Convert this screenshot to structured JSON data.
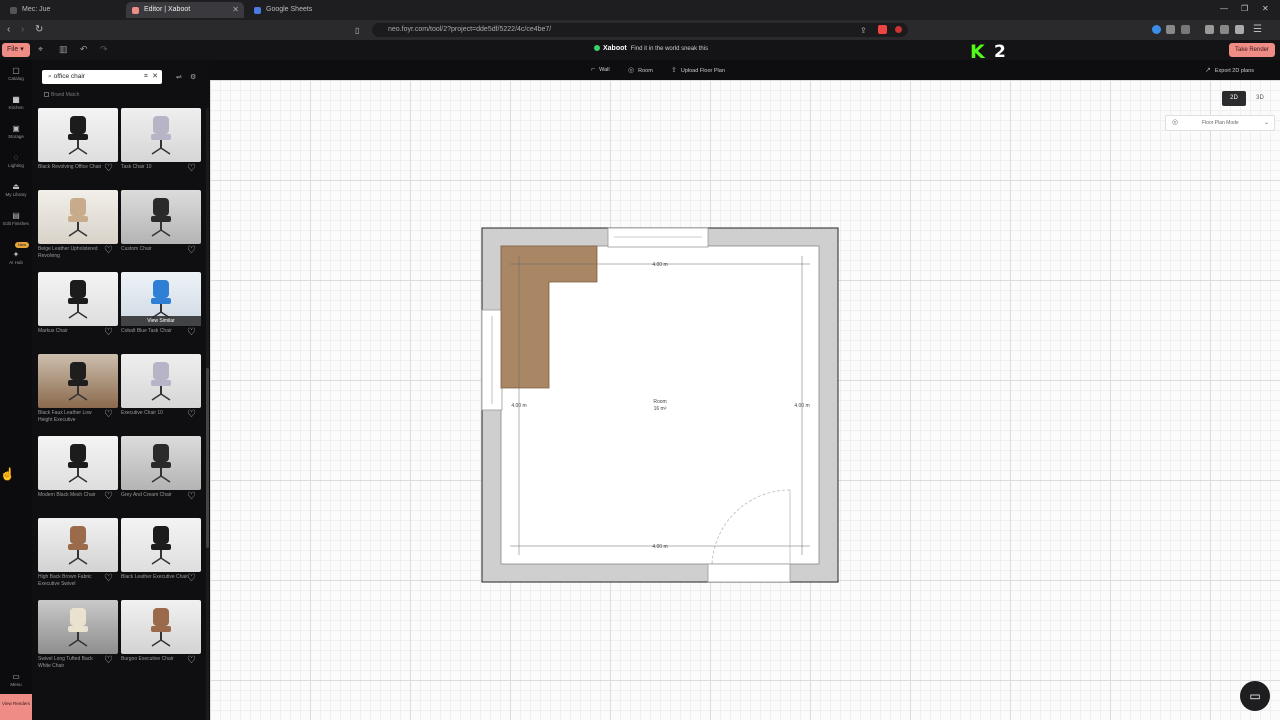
{
  "browser": {
    "tabs": [
      {
        "label": "Mec: Jue",
        "active": false
      },
      {
        "label": "Editor | Xaboot",
        "active": true
      },
      {
        "label": "Google Sheets",
        "active": false
      }
    ],
    "url": "neo.foyr.com/tool/2?project=dde5df/5222/4c/ce4be7/"
  },
  "app": {
    "file_label": "File",
    "brand_name": "Xaboot",
    "brand_tagline": "Find it in the world sneak this",
    "take_render_label": "Take Render",
    "stream": {
      "logo": "K",
      "count": "2"
    }
  },
  "rail": {
    "items": [
      {
        "label": "Catalog",
        "icon": "catalog-icon"
      },
      {
        "label": "Kitchen",
        "icon": "kitchen-icon"
      },
      {
        "label": "Storage",
        "icon": "storage-icon"
      },
      {
        "label": "Lighting",
        "icon": "lighting-icon"
      },
      {
        "label": "My Library",
        "icon": "library-icon"
      },
      {
        "label": "Edit Finishes",
        "icon": "finishes-icon"
      },
      {
        "label": "AI Hub",
        "icon": "ai-hub-icon",
        "badge": "New"
      }
    ],
    "bottom_items": [
      {
        "label": "Menu",
        "icon": "menu-icon"
      }
    ],
    "view_renders_label": "View Renders"
  },
  "panel": {
    "search_value": "office chair",
    "toggle_label": "Brand Match",
    "view_similar_label": "View Similar",
    "products": [
      {
        "name": "Black Revolving Office Chair",
        "swatch": "dark"
      },
      {
        "name": "Task Chair 10",
        "swatch": "light"
      },
      {
        "name": "Beige Leather Upholstered Revolving",
        "swatch": "beige"
      },
      {
        "name": "Custom Chair",
        "swatch": "gray"
      },
      {
        "name": "Markus Chair",
        "swatch": "dark"
      },
      {
        "name": "Cobalt Blue Task Chair",
        "swatch": "blue"
      },
      {
        "name": "Black Faux Leather Low Height Executive",
        "swatch": "wood"
      },
      {
        "name": "Executive Chair 10",
        "swatch": "light"
      },
      {
        "name": "Modern Black Mesh Chair",
        "swatch": "dark"
      },
      {
        "name": "Grey And Cream Chair",
        "swatch": "gray"
      },
      {
        "name": "High Back Brown Fabric Executive Swivel",
        "swatch": "brown"
      },
      {
        "name": "Black Leather Executive Chair",
        "swatch": "dark"
      },
      {
        "name": "Swivel Long Tufted Back White Chair",
        "swatch": "cream"
      },
      {
        "name": "Burgoo Executive Chair",
        "swatch": "brown"
      }
    ]
  },
  "canvas": {
    "tools": [
      {
        "label": "Wall",
        "icon": "wall-icon"
      },
      {
        "label": "Room",
        "icon": "room-icon"
      },
      {
        "label": "Upload Floor Plan",
        "icon": "upload-icon"
      }
    ],
    "export_label": "Export 2D plans",
    "view_2d": "2D",
    "view_3d": "3D",
    "mode_label": "Floor Plan Mode",
    "room": {
      "label_line1": "Room",
      "label_line2": "16 m²",
      "dim_top": "4.00 m",
      "dim_left": "4.00 m",
      "dim_right": "4.00 m",
      "dim_bottom": "4.00 m"
    }
  },
  "colors": {
    "accent": "#ee8c85",
    "kick_green": "#53fc18",
    "desk": "#a98764",
    "wall": "#cfcfcf"
  }
}
